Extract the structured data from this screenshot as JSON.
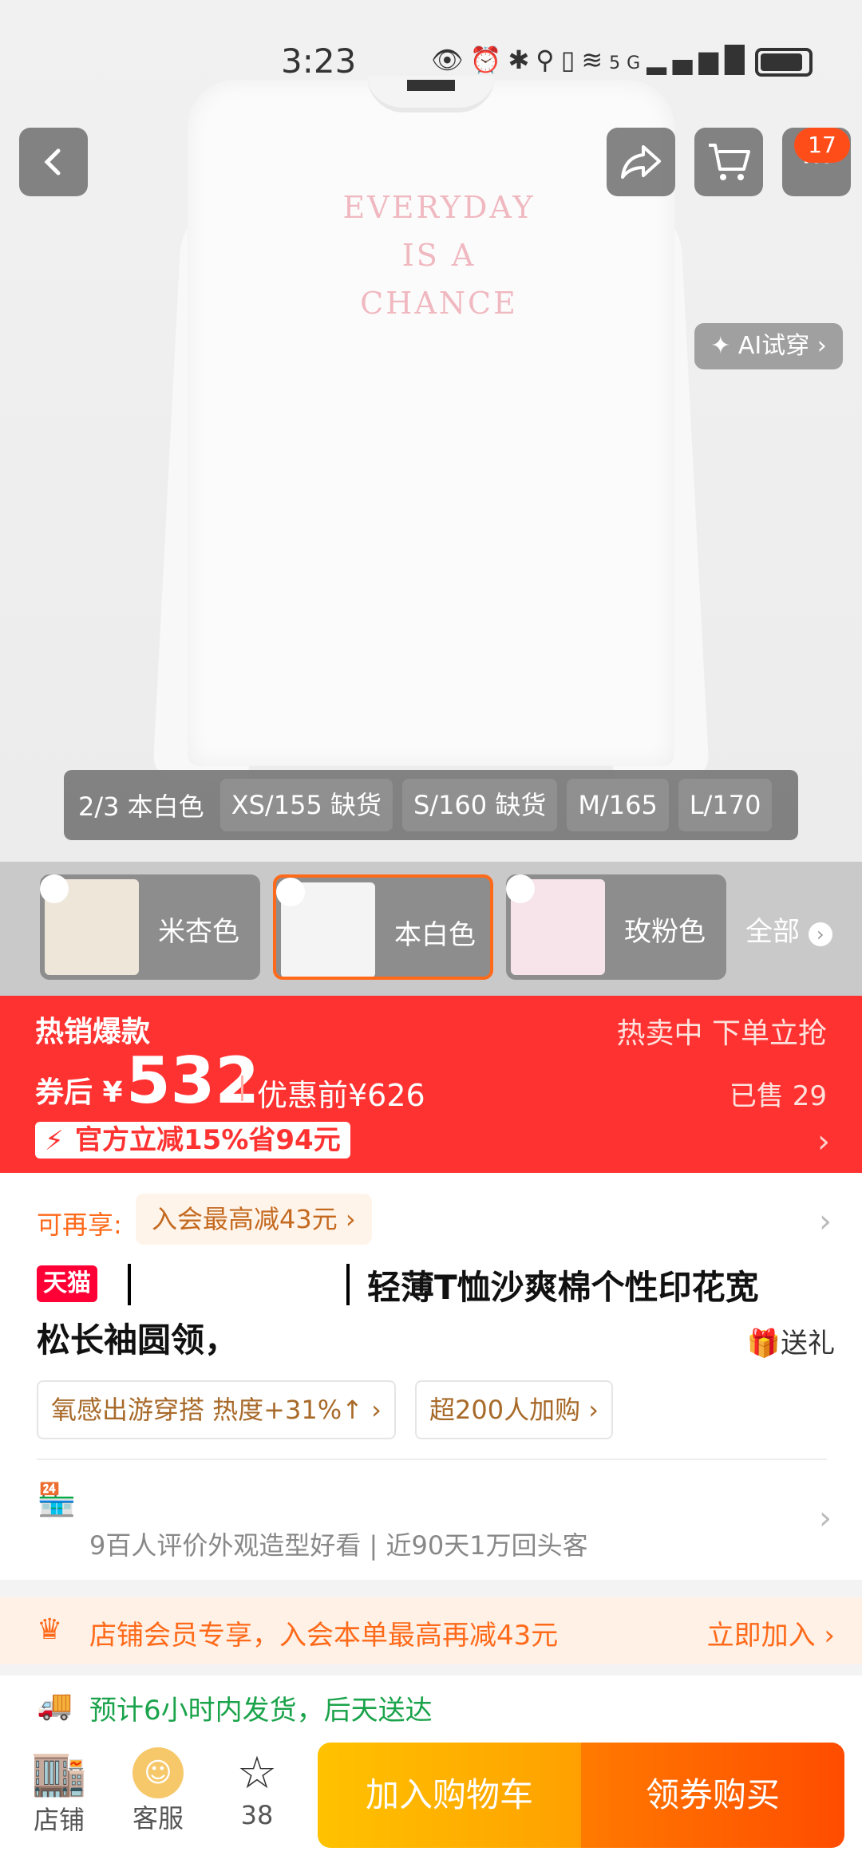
{
  "status_bar": {
    "time": "3:23",
    "network": "5G",
    "icons": [
      "eye-icon",
      "alarm-icon",
      "bluetooth-icon",
      "location-icon",
      "vibrate-icon",
      "wifi-icon",
      "signal-icon",
      "battery-icon"
    ]
  },
  "gallery": {
    "print_lines": [
      "EVERYDAY",
      "IS A",
      "CHANCE"
    ],
    "position": "2/3 本白色",
    "sizes": [
      "XS/155 缺货",
      "S/160 缺货",
      "M/165",
      "L/170"
    ],
    "ai_tryon": "✦ AI试穿 ›",
    "cart_badge": "17"
  },
  "colors": {
    "options": [
      {
        "name": "米杏色",
        "thumb": "#efe6da"
      },
      {
        "name": "本白色",
        "thumb": "#f4f4f4"
      },
      {
        "name": "玫粉色",
        "thumb": "#f6e4ea"
      }
    ],
    "all_label": "全部"
  },
  "price": {
    "hot_label": "热销爆款",
    "rush": "热卖中 下单立抢",
    "after_coupon": "券后 ¥",
    "value": "532",
    "before": "优惠前¥626",
    "sold": "已售 29",
    "promo": "官方立减15%省94元"
  },
  "info": {
    "enjoy_label": "可再享:",
    "member_offer": "入会最高减43元 ›",
    "tmall": "天猫",
    "title_line1": "轻薄T恤沙爽棉个性印花宽",
    "title_line2": "松长袖圆领，",
    "gift": "送礼",
    "tags": [
      "氧感出游穿搭 热度+31%↑ ›",
      "超200人加购 ›"
    ],
    "review": "9百人评价外观造型好看 | 近90天1万回头客"
  },
  "member_strip": {
    "text": "店铺会员专享，入会本单最高再减43元",
    "join": "立即加入 ›"
  },
  "shipping": {
    "text": "预计6小时内发货，后天送达"
  },
  "bottom_bar": {
    "shop": "店铺",
    "service": "客服",
    "favorites": "38",
    "add_cart": "加入购物车",
    "buy": "领券购买"
  },
  "colors_theme": {
    "accent": "#ff3232",
    "orange": "#ff6a1a",
    "green": "#1aa34a"
  }
}
